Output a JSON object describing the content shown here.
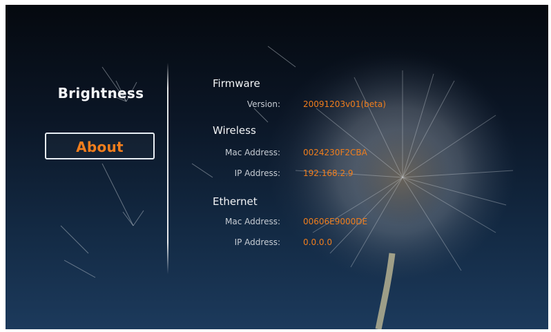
{
  "menu": {
    "items": [
      {
        "label": "Brightness",
        "selected": false
      },
      {
        "label": "About",
        "selected": true
      }
    ]
  },
  "about": {
    "firmware": {
      "title": "Firmware",
      "version_label": "Version:",
      "version_value": "20091203v01(beta)"
    },
    "wireless": {
      "title": "Wireless",
      "mac_label": "Mac Address:",
      "mac_value": "0024230F2CBA",
      "ip_label": "IP Address:",
      "ip_value": "192.168.2.9"
    },
    "ethernet": {
      "title": "Ethernet",
      "mac_label": "Mac Address:",
      "mac_value": "00606E9000DE",
      "ip_label": "IP Address:",
      "ip_value": "0.0.0.0"
    }
  },
  "colors": {
    "accent": "#f07e1d",
    "text": "#f2f4f6",
    "label": "#c7cdd4"
  }
}
